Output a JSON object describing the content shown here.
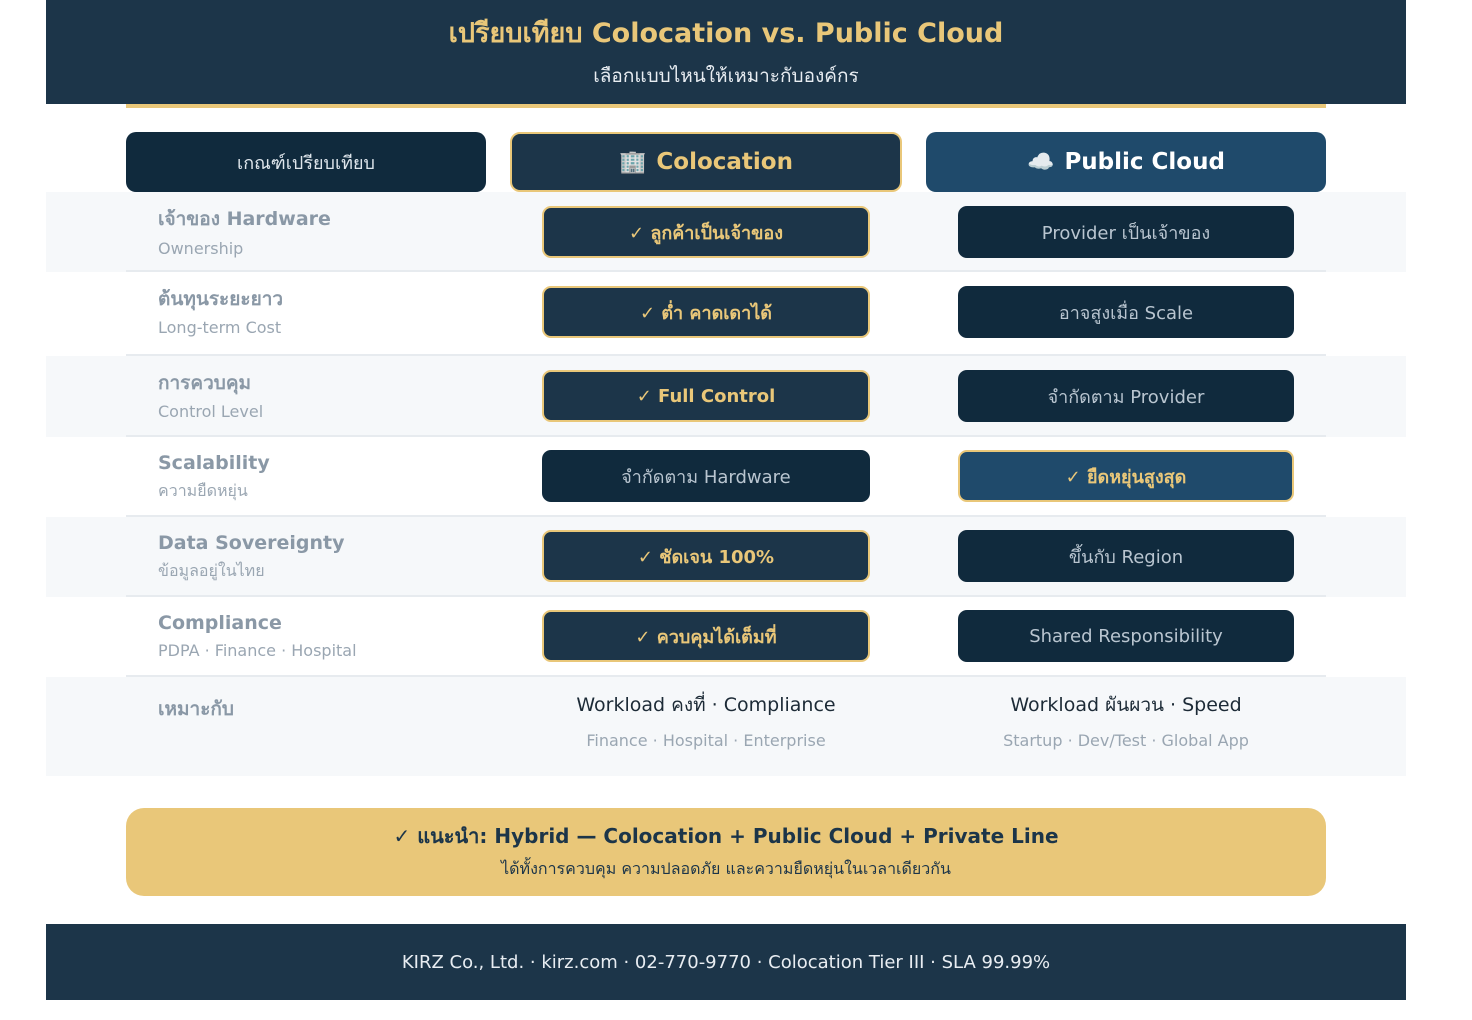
{
  "header": {
    "title": "เปรียบเทียบ Colocation vs. Public Cloud",
    "subtitle": "เลือกแบบไหนให้เหมาะกับองค์กร"
  },
  "table_header": {
    "criteria": "เกณฑ์เปรียบเทียบ",
    "colocation": "Colocation",
    "colocation_icon": "🏢",
    "public_cloud": "Public Cloud",
    "public_cloud_icon": "☁️"
  },
  "rows": [
    {
      "main": "เจ้าของ Hardware",
      "sub": "Ownership",
      "colocation": "✓ ลูกค้าเป็นเจ้าของ",
      "public_cloud": "Provider เป็นเจ้าของ"
    },
    {
      "main": "ต้นทุนระยะยาว",
      "sub": "Long-term Cost",
      "colocation": "✓ ต่ำ คาดเดาได้",
      "public_cloud": "อาจสูงเมื่อ Scale"
    },
    {
      "main": "การควบคุม",
      "sub": "Control Level",
      "colocation": "✓ Full Control",
      "public_cloud": "จำกัดตาม Provider"
    },
    {
      "main": "Scalability",
      "sub": "ความยืดหยุ่น",
      "colocation": "จำกัดตาม Hardware",
      "public_cloud": "✓ ยืดหยุ่นสูงสุด"
    },
    {
      "main": "Data Sovereignty",
      "sub": "ข้อมูลอยู่ในไทย",
      "colocation": "✓ ชัดเจน 100%",
      "public_cloud": "ขึ้นกับ Region"
    },
    {
      "main": "Compliance",
      "sub": "PDPA · Finance · Hospital",
      "colocation": "✓ ควบคุมได้เต็มที่",
      "public_cloud": "Shared Responsibility"
    }
  ],
  "fit": {
    "label": "เหมาะกับ",
    "colocation_main": "Workload คงที่ · Compliance",
    "colocation_sub": "Finance · Hospital · Enterprise",
    "public_cloud_main": "Workload ผันผวน · Speed",
    "public_cloud_sub": "Startup · Dev/Test · Global App"
  },
  "recommendation": {
    "title": "✓ แนะนำ: Hybrid — Colocation + Public Cloud + Private Line",
    "subtitle": "ได้ทั้งการควบคุม ความปลอดภัย และความยืดหยุ่นในเวลาเดียวกัน"
  },
  "footer": {
    "text": "KIRZ Co., Ltd. · kirz.com · 02-770-9770 · Colocation Tier III · SLA 99.99%"
  },
  "colors": {
    "navy": "#1c3549",
    "gold": "#e9c779",
    "cloud_blue": "#1f4a6b"
  }
}
